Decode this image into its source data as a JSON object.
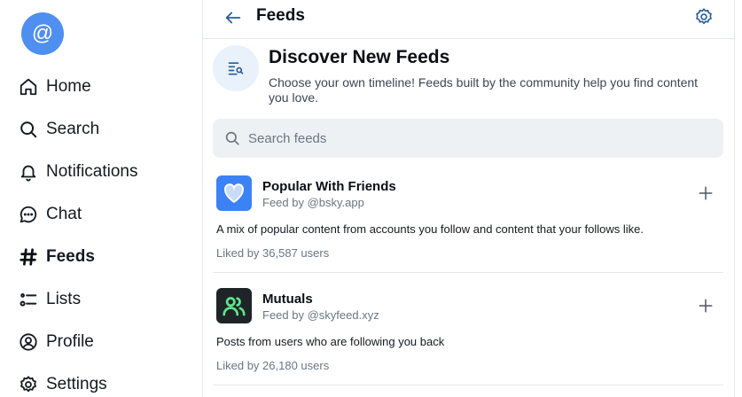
{
  "sidebar": {
    "avatar_glyph": "@",
    "items": [
      {
        "label": "Home",
        "icon": "home-icon"
      },
      {
        "label": "Search",
        "icon": "search-icon"
      },
      {
        "label": "Notifications",
        "icon": "bell-icon"
      },
      {
        "label": "Chat",
        "icon": "chat-icon"
      },
      {
        "label": "Feeds",
        "icon": "hash-icon",
        "active": true
      },
      {
        "label": "Lists",
        "icon": "list-icon"
      },
      {
        "label": "Profile",
        "icon": "profile-icon"
      },
      {
        "label": "Settings",
        "icon": "gear-icon"
      }
    ]
  },
  "header": {
    "title": "Feeds"
  },
  "discover": {
    "title": "Discover New Feeds",
    "description": "Choose your own timeline! Feeds built by the community help you find content you love."
  },
  "search": {
    "placeholder": "Search feeds"
  },
  "feeds": [
    {
      "name": "Popular With Friends",
      "by": "Feed by @bsky.app",
      "description": "A mix of popular content from accounts you follow and content that your follows like.",
      "likes": "Liked by 36,587 users",
      "icon": "heart-icon"
    },
    {
      "name": "Mutuals",
      "by": "Feed by @skyfeed.xyz",
      "description": "Posts from users who are following you back",
      "likes": "Liked by 26,180 users",
      "icon": "mutuals-icon"
    }
  ],
  "colors": {
    "accent": "#4f8ff0",
    "divider": "#e3e7eb",
    "muted_text": "#6b7682"
  }
}
